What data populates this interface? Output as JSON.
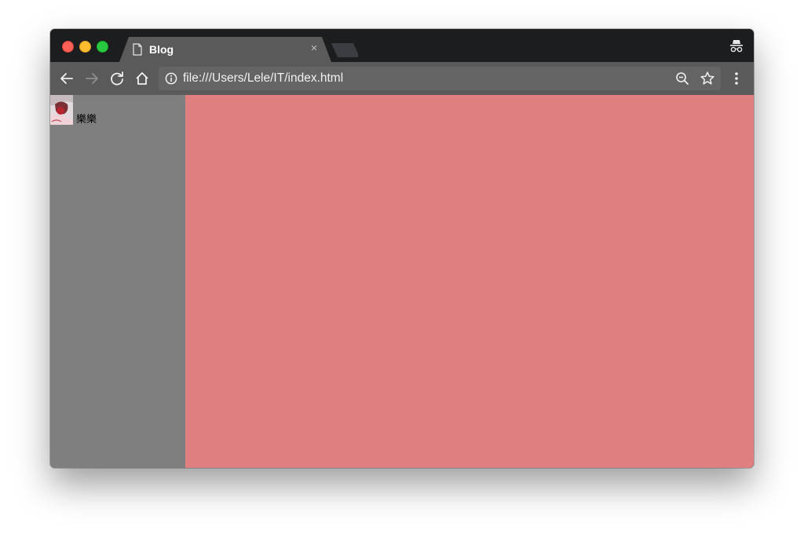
{
  "browser": {
    "tab": {
      "title": "Blog",
      "close_glyph": "×",
      "icon": "document-icon"
    },
    "new_tab_icon": "new-tab-icon",
    "incognito_icon": "incognito-icon",
    "toolbar": {
      "back_icon": "back-arrow-icon",
      "forward_icon": "forward-arrow-icon",
      "reload_icon": "reload-icon",
      "home_icon": "home-icon",
      "info_icon": "info-icon",
      "url": "file:///Users/Lele/IT/index.html",
      "zoom_icon": "zoom-icon",
      "bookmark_icon": "star-icon",
      "menu_icon": "kebab-menu-icon"
    }
  },
  "page": {
    "sidebar": {
      "avatar_name": "樂樂"
    }
  },
  "colors": {
    "sidebar_bg": "#7f7f7f",
    "main_bg": "#e07f80",
    "toolbar_bg": "#5a5a5a",
    "titlebar_bg": "#1c1d1f"
  }
}
